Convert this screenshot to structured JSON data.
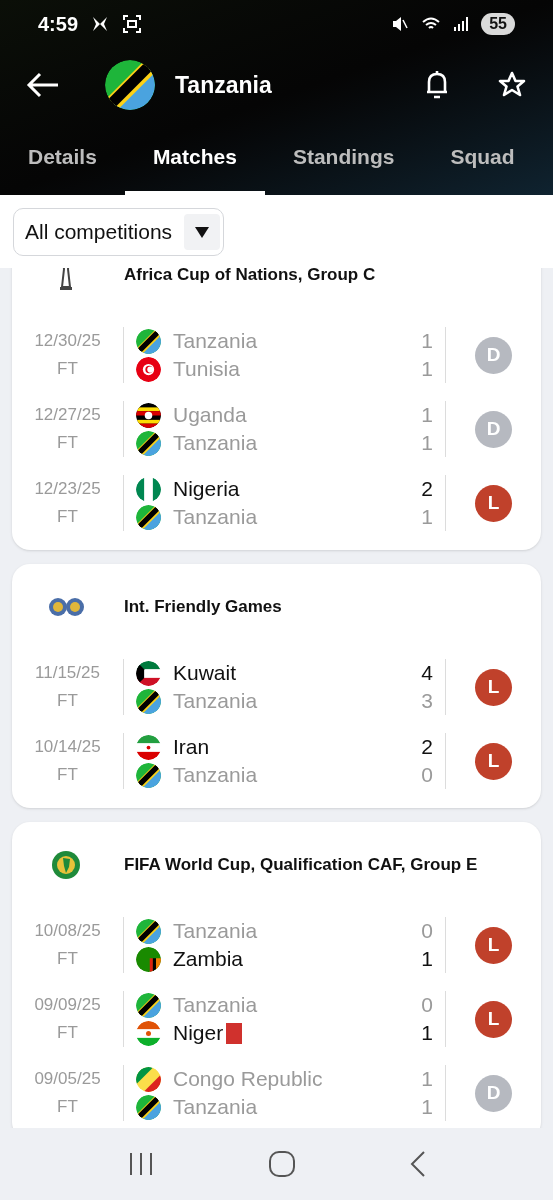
{
  "status_bar": {
    "time": "4:59",
    "battery": "55"
  },
  "header": {
    "title": "Tanzania",
    "kind": "tanzania"
  },
  "tabs": [
    {
      "label": "Details",
      "selected": false
    },
    {
      "label": "Matches",
      "selected": true
    },
    {
      "label": "Standings",
      "selected": false
    },
    {
      "label": "Squad",
      "selected": false
    }
  ],
  "filter": {
    "value": "All competitions"
  },
  "competitions": [
    {
      "name": "Africa Cup of Nations, Group C",
      "kind": "trophy",
      "matches": [
        {
          "date": "12/30/25",
          "status": "FT",
          "home": {
            "name": "Tanzania",
            "kind": "tanzania",
            "winner": false,
            "score": "1"
          },
          "away": {
            "name": "Tunisia",
            "kind": "tunisia",
            "winner": false,
            "score": "1"
          },
          "result": "D",
          "color": "#b6b9c0"
        },
        {
          "date": "12/27/25",
          "status": "FT",
          "home": {
            "name": "Uganda",
            "kind": "uganda",
            "winner": false,
            "score": "1"
          },
          "away": {
            "name": "Tanzania",
            "kind": "tanzania",
            "winner": false,
            "score": "1"
          },
          "result": "D",
          "color": "#b6b9c0"
        },
        {
          "date": "12/23/25",
          "status": "FT",
          "home": {
            "name": "Nigeria",
            "kind": "nigeria",
            "winner": true,
            "score": "2"
          },
          "away": {
            "name": "Tanzania",
            "kind": "tanzania",
            "winner": false,
            "score": "1"
          },
          "result": "L",
          "color": "#c0412b"
        }
      ]
    },
    {
      "name": "Int. Friendly Games",
      "kind": "balls",
      "matches": [
        {
          "date": "11/15/25",
          "status": "FT",
          "home": {
            "name": "Kuwait",
            "kind": "kuwait",
            "winner": true,
            "score": "4"
          },
          "away": {
            "name": "Tanzania",
            "kind": "tanzania",
            "winner": false,
            "score": "3"
          },
          "result": "L",
          "color": "#c0412b"
        },
        {
          "date": "10/14/25",
          "status": "FT",
          "home": {
            "name": "Iran",
            "kind": "iran",
            "winner": true,
            "score": "2"
          },
          "away": {
            "name": "Tanzania",
            "kind": "tanzania",
            "winner": false,
            "score": "0"
          },
          "result": "L",
          "color": "#c0412b"
        }
      ]
    },
    {
      "name": "FIFA World Cup, Qualification CAF, Group E",
      "kind": "emblem",
      "matches": [
        {
          "date": "10/08/25",
          "status": "FT",
          "home": {
            "name": "Tanzania",
            "kind": "tanzania",
            "winner": false,
            "score": "0"
          },
          "away": {
            "name": "Zambia",
            "kind": "zambia",
            "winner": true,
            "score": "1"
          },
          "result": "L",
          "color": "#c0412b"
        },
        {
          "date": "09/09/25",
          "status": "FT",
          "home": {
            "name": "Tanzania",
            "kind": "tanzania",
            "winner": false,
            "score": "0"
          },
          "away": {
            "name": "Niger",
            "kind": "niger",
            "winner": true,
            "score": "1",
            "red_card": true
          },
          "result": "L",
          "color": "#c0412b"
        },
        {
          "date": "09/05/25",
          "status": "FT",
          "home": {
            "name": "Congo Republic",
            "kind": "congo",
            "winner": false,
            "score": "1"
          },
          "away": {
            "name": "Tanzania",
            "kind": "tanzania",
            "winner": false,
            "score": "1"
          },
          "result": "D",
          "color": "#b6b9c0"
        }
      ]
    }
  ]
}
